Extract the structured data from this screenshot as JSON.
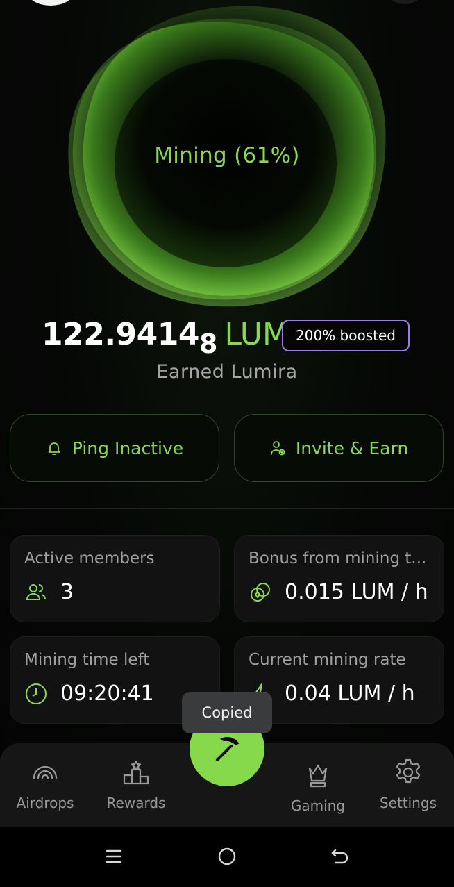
{
  "mining": {
    "label": "Mining (61%)",
    "progress_percent": 61
  },
  "balance": {
    "value_main": "122.9414",
    "value_last_digit": "8",
    "unit": "LUM",
    "boost_badge": "200% boosted",
    "caption": "Earned Lumira"
  },
  "actions": {
    "ping_label": "Ping Inactive",
    "ping_icon": "bell-icon",
    "invite_label": "Invite & Earn",
    "invite_icon": "user-add-icon"
  },
  "stats": [
    {
      "label": "Active members",
      "value": "3",
      "icon": "users-icon"
    },
    {
      "label": "Bonus from mining t...",
      "value": "0.015 LUM / h",
      "icon": "coins-icon"
    },
    {
      "label": "Mining time left",
      "value": "09:20:41",
      "icon": "clock-icon"
    },
    {
      "label": "Current mining rate",
      "value": "0.04 LUM / h",
      "icon": "bolt-icon"
    }
  ],
  "toast": {
    "text": "Copied"
  },
  "bottom_nav": {
    "items": [
      {
        "label": "Airdrops",
        "icon": "airdrop-icon"
      },
      {
        "label": "Rewards",
        "icon": "podium-icon"
      },
      {
        "label": "Gaming",
        "icon": "crown-icon"
      },
      {
        "label": "Settings",
        "icon": "gear-icon"
      }
    ],
    "center_button_icon": "pickaxe-icon"
  },
  "colors": {
    "accent": "#86d94a",
    "badge_border": "#9b7cf0",
    "background": "#050705"
  }
}
